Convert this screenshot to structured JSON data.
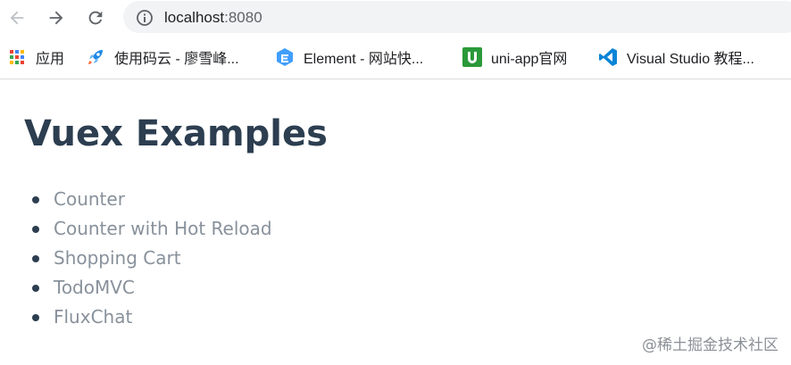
{
  "browser": {
    "url_host": "localhost",
    "url_port": ":8080",
    "icons": [
      "back-arrow-icon",
      "forward-arrow-icon",
      "reload-icon",
      "info-icon"
    ]
  },
  "bookmarks": [
    {
      "label": "应用",
      "icon": "apps-grid-icon"
    },
    {
      "label": "使用码云 - 廖雪峰...",
      "icon": "rocket-icon"
    },
    {
      "label": "Element - 网站快...",
      "icon": "element-logo-icon"
    },
    {
      "label": "uni-app官网",
      "icon": "uni-app-logo-icon"
    },
    {
      "label": "Visual Studio 教程...",
      "icon": "vscode-logo-icon"
    }
  ],
  "page": {
    "title": "Vuex Examples",
    "examples": [
      {
        "label": "Counter"
      },
      {
        "label": "Counter with Hot Reload"
      },
      {
        "label": "Shopping Cart"
      },
      {
        "label": "TodoMVC"
      },
      {
        "label": "FluxChat"
      }
    ]
  },
  "watermark": "@稀土掘金技术社区",
  "colors": {
    "title": "#2c3e50",
    "link": "#88919b",
    "omnibox": "#f1f3f4"
  }
}
